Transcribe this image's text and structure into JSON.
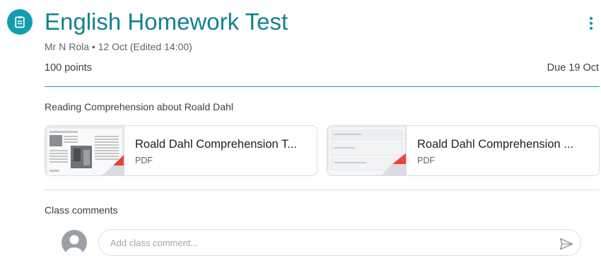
{
  "header": {
    "title": "English Homework Test",
    "meta": "Mr N Rola • 12 Oct (Edited 14:00)",
    "points": "100 points",
    "due": "Due 19 Oct",
    "assignment_icon": "assignment-icon",
    "more_icon": "more-vert-icon"
  },
  "instructions": "Reading Comprehension about Roald Dahl",
  "attachments": [
    {
      "title": "Roald Dahl Comprehension T...",
      "type": "PDF"
    },
    {
      "title": "Roald Dahl Comprehension ...",
      "type": "PDF"
    }
  ],
  "comments": {
    "label": "Class comments",
    "placeholder": "Add class comment...",
    "send_icon": "send-icon",
    "avatar_icon": "person-icon"
  },
  "colors": {
    "accent": "#129eaf",
    "pdf_badge": "#ea4335"
  }
}
